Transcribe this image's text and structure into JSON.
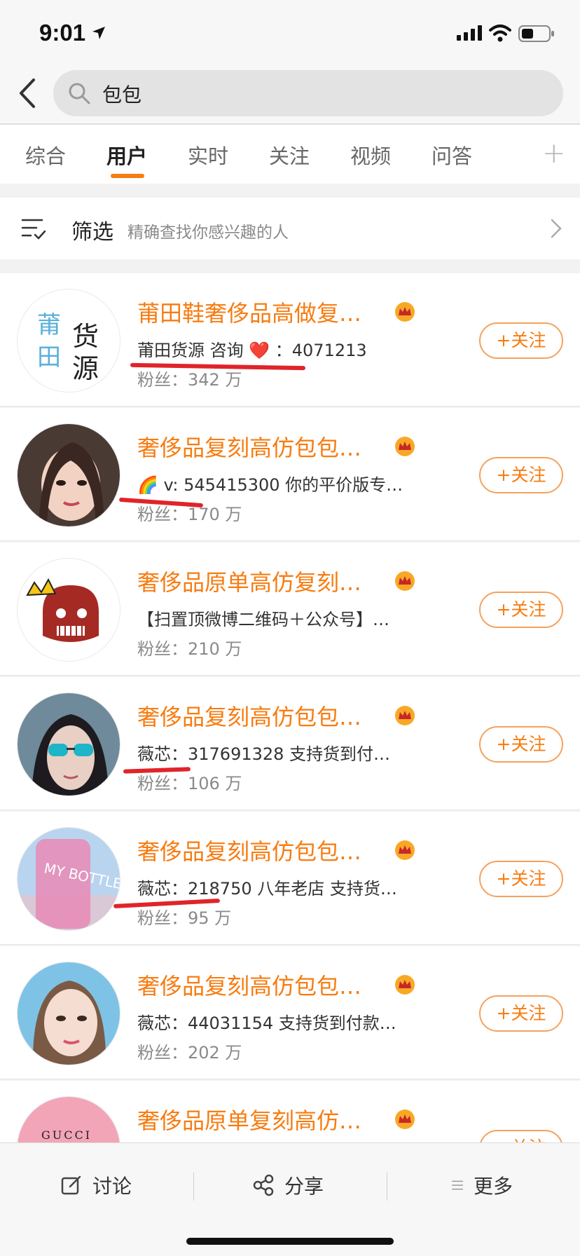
{
  "status": {
    "time": "9:01"
  },
  "search": {
    "query": "包包"
  },
  "tabs": [
    {
      "label": "综合"
    },
    {
      "label": "用户"
    },
    {
      "label": "实时"
    },
    {
      "label": "关注"
    },
    {
      "label": "视频"
    },
    {
      "label": "问答"
    }
  ],
  "tabs_active": "用户",
  "tab_plus": "+",
  "filter": {
    "label": "筛选",
    "description": "精确查找你感兴趣的人"
  },
  "users": [
    {
      "name": "莆田鞋奢侈品高做复…",
      "desc": "莆田货源 咨询 ❤️ ：4071213",
      "fans": "粉丝：342 万",
      "follow": "+关注",
      "avatar_text": "莆田货源"
    },
    {
      "name": "奢侈品复刻高仿包包…",
      "desc": "🌈 v: 545415300 你的平价版专…",
      "fans": "粉丝：170 万",
      "follow": "+关注"
    },
    {
      "name": "奢侈品原单高仿复刻…",
      "desc": "【扫置顶微博二维码＋公众号】…",
      "fans": "粉丝：210 万",
      "follow": "+关注"
    },
    {
      "name": "奢侈品复刻高仿包包…",
      "desc": "薇芯：317691328 支持货到付…",
      "fans": "粉丝：106 万",
      "follow": "+关注"
    },
    {
      "name": "奢侈品复刻高仿包包…",
      "desc": "薇芯：218750 八年老店 支持货…",
      "fans": "粉丝：95 万",
      "follow": "+关注",
      "avatar_text": "MY BOTTLE"
    },
    {
      "name": "奢侈品复刻高仿包包…",
      "desc": "薇芯：44031154 支持货到付款…",
      "fans": "粉丝：202 万",
      "follow": "+关注"
    },
    {
      "name": "奢侈品原单复刻高仿…",
      "desc": "",
      "fans": "",
      "follow": "+关注",
      "avatar_text": "GUCCI"
    }
  ],
  "bottom_bar": {
    "discuss": "讨论",
    "share": "分享",
    "more": "更多"
  },
  "colors": {
    "accent": "#f77c11",
    "mark": "#e0242a"
  }
}
